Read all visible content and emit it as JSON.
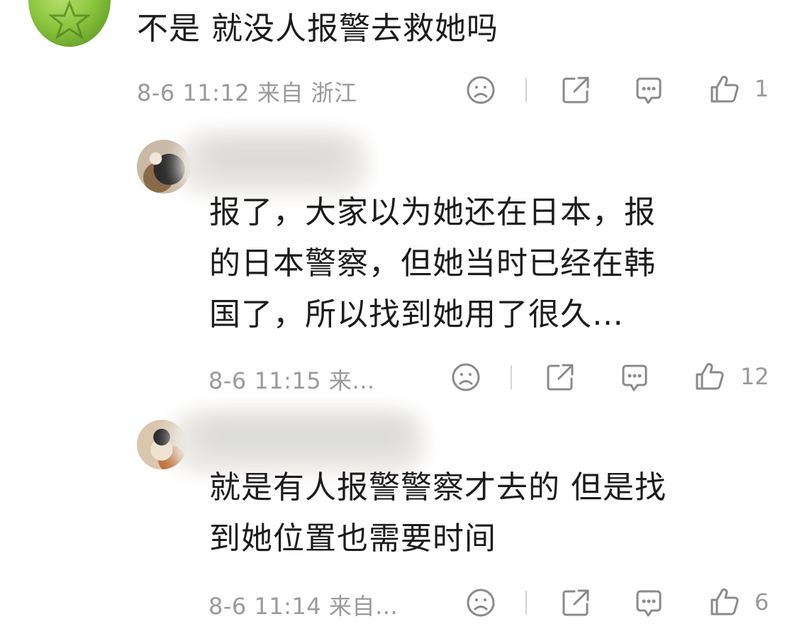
{
  "top_comment": {
    "text": "不是 就没人报警去救她吗",
    "meta": "8-6 11:12 来自 浙江",
    "likes": "1"
  },
  "replies": [
    {
      "text_lines": [
        "报了，大家以为她还在日本，报",
        "的日本警察，但她当时已经在韩",
        "国了，所以找到她用了很久…"
      ],
      "meta": "8-6 11:15 来…",
      "likes": "12"
    },
    {
      "text_lines": [
        "就是有人报警警察才去的 但是找",
        "到她位置也需要时间"
      ],
      "meta": "8-6 11:14 来自…",
      "likes": "6"
    }
  ],
  "icons": {
    "react": "sad-face-icon",
    "share": "share-icon",
    "reply": "comment-bubble-icon",
    "like": "thumbs-up-icon"
  },
  "colors": {
    "text": "#1c1c1c",
    "meta": "#9a9a9a",
    "icon": "#8a8a8a",
    "avatar_green": "#8cc63f"
  }
}
